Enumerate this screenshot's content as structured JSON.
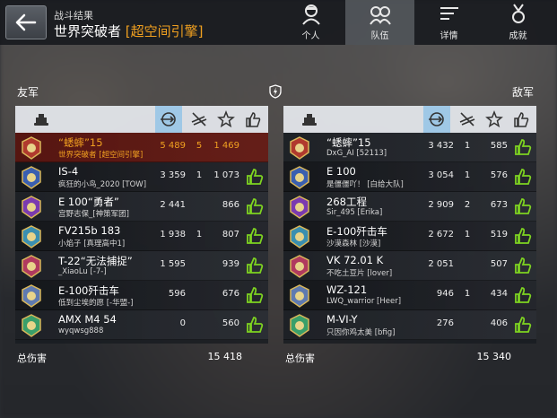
{
  "header": {
    "subtitle": "战斗结果",
    "mode": "世界突破者",
    "clan": "[超空间引擎]"
  },
  "tabs": [
    {
      "label": "个人",
      "icon": "single-soldier-icon",
      "active": false
    },
    {
      "label": "队伍",
      "icon": "team-soldiers-icon",
      "active": true
    },
    {
      "label": "详情",
      "icon": "details-lines-icon",
      "active": false
    },
    {
      "label": "成就",
      "icon": "medal-icon",
      "active": false
    }
  ],
  "allies_label": "友军",
  "enemies_label": "敌军",
  "total_label": "总伤害",
  "allies_total": "15 418",
  "enemies_total": "15 340",
  "colors": {
    "highlight": "#f0a020",
    "like_active": "#7ed321",
    "header_selected": "#9fc8e6"
  },
  "allies": [
    {
      "tank": "“蟋蟀”15",
      "player": "世界突破者 [超空间引擎]",
      "damage": "5 489",
      "kills": "5",
      "score": "1 469",
      "me": true,
      "liked": false
    },
    {
      "tank": "IS-4",
      "player": "疯狂的小鸟_2020 [TOW]",
      "damage": "3 359",
      "kills": "1",
      "score": "1 073",
      "me": false,
      "liked": true
    },
    {
      "tank": "E 100“勇者”",
      "player": "宫野志保_[神策军团]",
      "damage": "2 441",
      "kills": "",
      "score": "866",
      "me": false,
      "liked": true
    },
    {
      "tank": "FV215b 183",
      "player": "小焰子 [真理高中1]",
      "damage": "1 938",
      "kills": "1",
      "score": "807",
      "me": false,
      "liked": true
    },
    {
      "tank": "T-22“无法捕捉”",
      "player": "_XiaoLu [-7-]",
      "damage": "1 595",
      "kills": "",
      "score": "939",
      "me": false,
      "liked": true
    },
    {
      "tank": "E-100歼击车",
      "player": "低到尘埃的愿 [-华盟-]",
      "damage": "596",
      "kills": "",
      "score": "676",
      "me": false,
      "liked": true
    },
    {
      "tank": "AMX M4 54",
      "player": "wyqwsg888",
      "damage": "0",
      "kills": "",
      "score": "560",
      "me": false,
      "liked": true
    }
  ],
  "enemies": [
    {
      "tank": "“蟋蟀”15",
      "player": "DxG_AI [52113]",
      "damage": "3 432",
      "kills": "1",
      "score": "585",
      "liked": true
    },
    {
      "tank": "E 100",
      "player": "是僵僵吖！ [白给大队]",
      "damage": "3 054",
      "kills": "1",
      "score": "576",
      "liked": true
    },
    {
      "tank": "268工程",
      "player": "Sir_495 [Erika]",
      "damage": "2 909",
      "kills": "2",
      "score": "673",
      "liked": true
    },
    {
      "tank": "E-100歼击车",
      "player": "沙漠森林 [沙漠]",
      "damage": "2 672",
      "kills": "1",
      "score": "519",
      "liked": true
    },
    {
      "tank": "VK 72.01 K",
      "player": "不吃土豆片 [lover]",
      "damage": "2 051",
      "kills": "",
      "score": "507",
      "liked": true
    },
    {
      "tank": "WZ-121",
      "player": "LWQ_warrior [Heer]",
      "damage": "946",
      "kills": "1",
      "score": "434",
      "liked": true
    },
    {
      "tank": "M-VI-Y",
      "player": "只因你鸡太美 [bfig]",
      "damage": "276",
      "kills": "",
      "score": "406",
      "liked": true
    }
  ]
}
